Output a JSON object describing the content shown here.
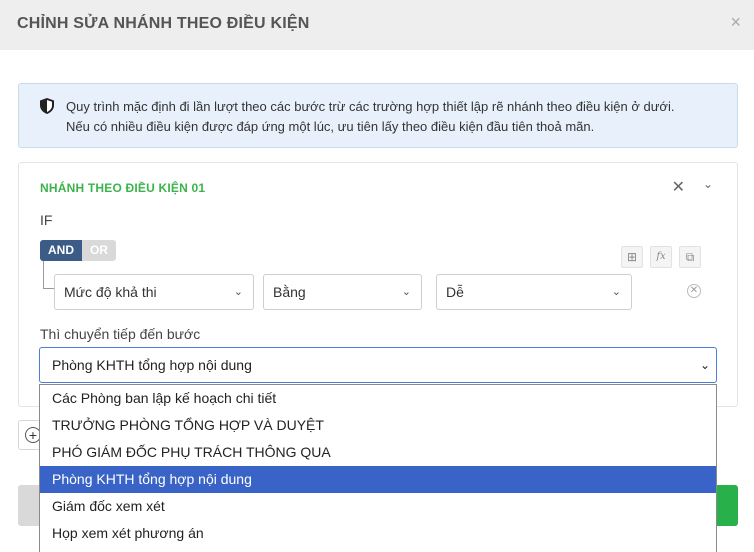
{
  "modal": {
    "title": "CHỈNH SỬA NHÁNH THEO ĐIỀU KIỆN",
    "close_glyph": "×"
  },
  "info": {
    "icon": "shield-icon",
    "line1": "Quy trình mặc định đi lần lượt theo các bước trừ các trường hợp thiết lập rẽ nhánh theo điều kiện ở dưới.",
    "line2": "Nếu có nhiều điều kiện được đáp ứng một lúc, ưu tiên lấy theo điều kiện đầu tiên thoả mãn."
  },
  "branch": {
    "title": "NHÁNH THEO ĐIỀU KIỆN 01",
    "if_label": "IF",
    "toggle": {
      "and": "AND",
      "or": "OR",
      "active": "AND"
    },
    "tools": {
      "add": "⊞",
      "fx": "fx",
      "copy": "⧉"
    },
    "condition": {
      "field": "Mức độ khả thi",
      "operator": "Bằng",
      "value": "Dễ"
    },
    "next_label": "Thì chuyển tiếp đến bước",
    "next_selected": "Phòng KHTH tổng hợp nội dung",
    "options": [
      "Các Phòng ban lập kế hoạch chi tiết",
      "TRƯỞNG PHÒNG TỔNG HỢP VÀ DUYỆT",
      "PHÓ GIÁM ĐỐC PHỤ TRÁCH THÔNG QUA",
      "Phòng KHTH tổng hợp nội dung",
      "Giám đốc xem xét",
      "Họp xem xét phương án"
    ],
    "selected_index": 3
  },
  "colors": {
    "accent_blue": "#3a63c8",
    "branch_green": "#3cb44b",
    "and_active": "#3a5c86",
    "confirm_green": "#28b04a",
    "info_bg": "#e8f1fb"
  }
}
